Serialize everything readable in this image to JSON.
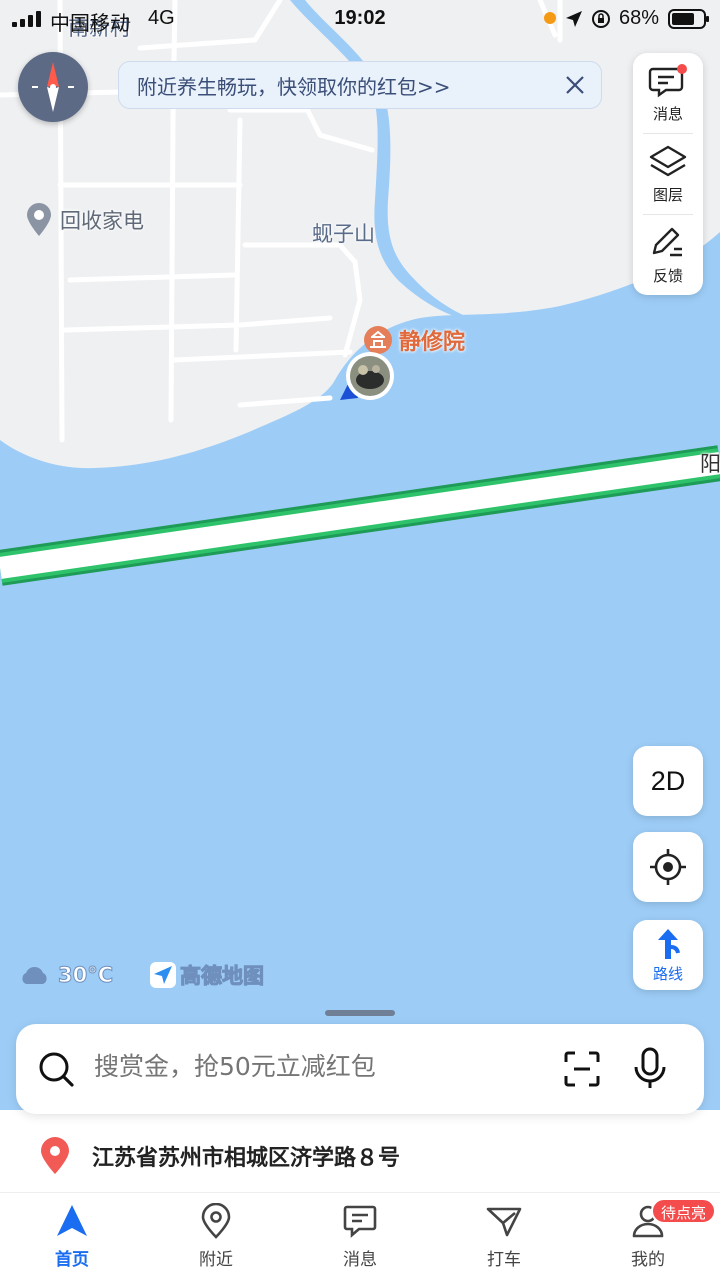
{
  "status_bar": {
    "carrier": "中国移动",
    "network": "4G",
    "time": "19:02",
    "battery": "68%"
  },
  "banner": {
    "text": "附近养生畅玩，快领取你的红包>>"
  },
  "map": {
    "labels": {
      "village_top": "南新村",
      "hill": "蚬子山",
      "recycle": "回收家电",
      "temple": "静修院",
      "road_edge": "阳"
    }
  },
  "tools": {
    "messages": "消息",
    "layers": "图层",
    "feedback": "反馈"
  },
  "view_mode": "2D",
  "route_label": "路线",
  "weather": {
    "temperature": "30°C"
  },
  "brand": {
    "name": "高德地图"
  },
  "search": {
    "placeholder": "搜赏金，抢50元立减红包"
  },
  "address": "江苏省苏州市相城区济学路８号",
  "tabs": [
    {
      "label": "首页"
    },
    {
      "label": "附近"
    },
    {
      "label": "消息"
    },
    {
      "label": "打车"
    },
    {
      "label": "我的"
    }
  ],
  "profile_badge": "待点亮",
  "colors": {
    "accent": "#1a6cf0",
    "water": "#9dcdf7",
    "land": "#eff0f2",
    "road_green": "#22b561",
    "badge_red": "#f44c4c"
  },
  "icons": [
    "signal-icon",
    "location-arrow-icon",
    "orientation-lock-icon",
    "battery-icon",
    "compass-icon",
    "close-icon",
    "message-icon",
    "layers-icon",
    "pencil-icon",
    "locate-icon",
    "route-arrow-icon",
    "cloud-icon",
    "amap-logo-icon",
    "search-icon",
    "scan-icon",
    "microphone-icon",
    "location-pin-icon",
    "home-nav-icon",
    "nearby-icon",
    "message-tab-icon",
    "taxi-icon",
    "profile-icon"
  ]
}
